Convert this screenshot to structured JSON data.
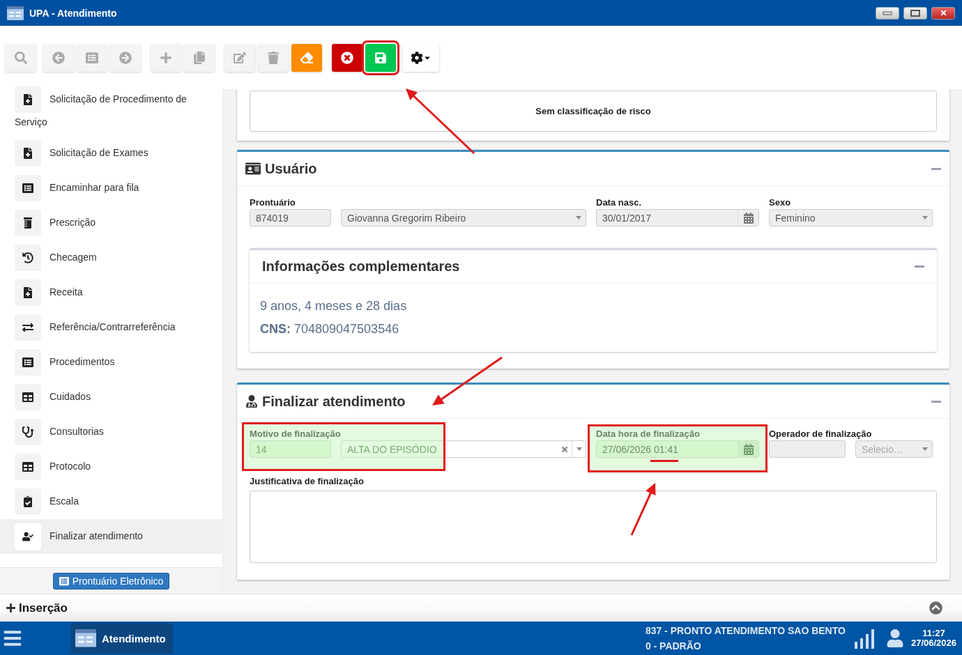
{
  "window": {
    "title": "UPA - Atendimento"
  },
  "toolbar": {
    "buttons": [
      {
        "kind": "search",
        "disabled": true,
        "highlighted": false
      },
      {
        "kind": "back",
        "disabled": true,
        "highlighted": false
      },
      {
        "kind": "list",
        "disabled": true,
        "highlighted": false
      },
      {
        "kind": "forward",
        "disabled": true,
        "highlighted": false
      },
      {
        "kind": "add",
        "disabled": true,
        "highlighted": false
      },
      {
        "kind": "copy",
        "disabled": true,
        "highlighted": false
      },
      {
        "kind": "edit",
        "disabled": true,
        "highlighted": false
      },
      {
        "kind": "delete",
        "disabled": true,
        "highlighted": false
      },
      {
        "kind": "erase",
        "disabled": false,
        "highlighted": false
      },
      {
        "kind": "cancel",
        "disabled": false,
        "highlighted": false
      },
      {
        "kind": "save",
        "disabled": false,
        "highlighted": true
      },
      {
        "kind": "settings",
        "disabled": false,
        "highlighted": false
      }
    ]
  },
  "sidebar": {
    "items": [
      {
        "label": "Solicitação de Procedimento de Serviço",
        "kind": "file-plus",
        "selected": false
      },
      {
        "label": "Solicitação de Exames",
        "kind": "file-plus",
        "selected": false
      },
      {
        "label": "Encaminhar para fila",
        "kind": "list",
        "selected": false
      },
      {
        "label": "Prescrição",
        "kind": "bottle",
        "selected": false
      },
      {
        "label": "Checagem",
        "kind": "history",
        "selected": false
      },
      {
        "label": "Receita",
        "kind": "file-plus",
        "selected": false
      },
      {
        "label": "Referência/Contrarreferência",
        "kind": "exchange",
        "selected": false
      },
      {
        "label": "Procedimentos",
        "kind": "list",
        "selected": false
      },
      {
        "label": "Cuidados",
        "kind": "table",
        "selected": false
      },
      {
        "label": "Consultorias",
        "kind": "stethoscope",
        "selected": false
      },
      {
        "label": "Protocolo",
        "kind": "table",
        "selected": false
      },
      {
        "label": "Escala",
        "kind": "clipboard",
        "selected": false
      },
      {
        "label": "Finalizar atendimento",
        "kind": "user-check",
        "selected": true
      }
    ],
    "footer_button": "Prontuário Eletrônico"
  },
  "risk_panel": {
    "text": "Sem classificação de risco"
  },
  "user_panel": {
    "title": "Usuário",
    "prontuario": {
      "label": "Prontuário",
      "code": "874019",
      "name": "Giovanna Gregorim Ribeiro"
    },
    "birth_date": {
      "label": "Data nasc.",
      "value": "30/01/2017"
    },
    "sex": {
      "label": "Sexo",
      "value": "Feminino"
    },
    "info": {
      "title": "Informações complementares",
      "age": "9 anos, 4 meses e 28 dias",
      "cns": "**CNS:** 704809047503546"
    }
  },
  "finish_panel": {
    "title": "Finalizar atendimento",
    "reason": {
      "label": "Motivo de finalização",
      "code": "14",
      "value": "ALTA DO EPISÓDIO",
      "highlighted": true
    },
    "datetime": {
      "label": "Data hora de finalização",
      "value": "27/06/2026 01:41",
      "highlighted": true
    },
    "operator": {
      "label": "Operador de finalização",
      "placeholder": "Selecio…"
    },
    "justification": {
      "label": "Justificativa de finalização"
    }
  },
  "insert_bar": {
    "label": "Inserção"
  },
  "taskbar": {
    "app": "Atendimento",
    "unit": "837 - PRONTO ATENDIMENTO SAO BENTO",
    "profile": "0 - PADRÃO",
    "time": "11:27",
    "date": "27/06/2026"
  }
}
